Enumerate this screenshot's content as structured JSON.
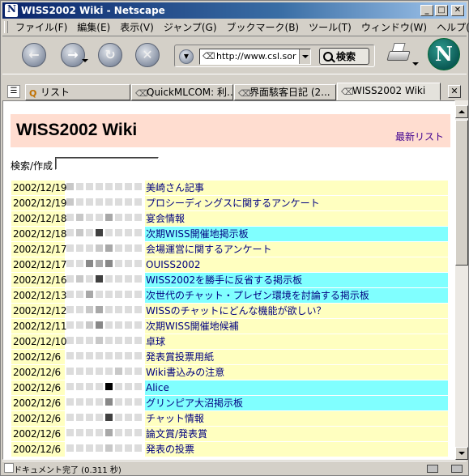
{
  "window": {
    "title": "WISS2002 Wiki - Netscape",
    "controls": {
      "minimize": "_",
      "maximize": "□",
      "close": "✕"
    }
  },
  "menu": [
    "ファイル(F)",
    "編集(E)",
    "表示(V)",
    "ジャンプ(G)",
    "ブックマーク(B)",
    "ツール(T)",
    "ウィンドウ(W)",
    "ヘルプ(H)"
  ],
  "toolbar": {
    "url": "http://www.csl.sor",
    "search_label": "検索",
    "back_glyph": "←",
    "forward_glyph": "→",
    "reload_glyph": "↻",
    "stop_glyph": "✕",
    "logo_letter": "N"
  },
  "tabs": [
    {
      "label": "リスト",
      "icon": "q-icon",
      "active": false
    },
    {
      "label": "QuickMLCOM: 利...",
      "icon": "page-icon",
      "active": false
    },
    {
      "label": "界面駭客日記 (2...",
      "icon": "page-icon",
      "active": false
    },
    {
      "label": "WISS2002 Wiki",
      "icon": "page-icon",
      "active": true
    }
  ],
  "page": {
    "title": "WISS2002 Wiki",
    "recent_link": "最新リスト",
    "search_label": "検索/作成"
  },
  "colors": {
    "header_bg": "#ffddd0",
    "row_bg": "#ffffc0",
    "row_highlight": "#80ffff",
    "link": "#000080"
  },
  "entries": [
    {
      "date": "2002/12/19",
      "title": "美崎さん記事",
      "highlight": false,
      "activity": [
        1,
        0,
        0,
        0,
        0,
        0,
        0,
        0
      ]
    },
    {
      "date": "2002/12/19",
      "title": "プロシーディングスに関するアンケート",
      "highlight": false,
      "activity": [
        1,
        0,
        0,
        0,
        0,
        0,
        0,
        0
      ]
    },
    {
      "date": "2002/12/18",
      "title": "宴会情報",
      "highlight": false,
      "activity": [
        0,
        1,
        0,
        0,
        2,
        0,
        0,
        0
      ]
    },
    {
      "date": "2002/12/18",
      "title": "次期WISS開催地掲示板",
      "highlight": true,
      "activity": [
        0,
        1,
        0,
        4,
        0,
        0,
        0,
        0
      ]
    },
    {
      "date": "2002/12/17",
      "title": "会場運営に関するアンケート",
      "highlight": false,
      "activity": [
        0,
        0,
        0,
        1,
        2,
        0,
        0,
        0
      ]
    },
    {
      "date": "2002/12/17",
      "title": "OUISS2002",
      "highlight": false,
      "activity": [
        0,
        0,
        3,
        2,
        3,
        0,
        0,
        0
      ]
    },
    {
      "date": "2002/12/16",
      "title": "WISS2002を勝手に反省する掲示板",
      "highlight": true,
      "activity": [
        0,
        1,
        0,
        4,
        0,
        0,
        0,
        0
      ]
    },
    {
      "date": "2002/12/13",
      "title": "次世代のチャット・プレゼン環境を討論する掲示板",
      "highlight": true,
      "activity": [
        0,
        0,
        2,
        0,
        0,
        0,
        0,
        0
      ]
    },
    {
      "date": "2002/12/12",
      "title": "WISSのチャットにどんな機能が欲しい？",
      "highlight": false,
      "activity": [
        0,
        0,
        1,
        2,
        0,
        0,
        0,
        0
      ]
    },
    {
      "date": "2002/12/11",
      "title": "次期WISS開催地候補",
      "highlight": false,
      "activity": [
        0,
        0,
        1,
        3,
        0,
        0,
        0,
        0
      ]
    },
    {
      "date": "2002/12/10",
      "title": "卓球",
      "highlight": false,
      "activity": [
        0,
        0,
        0,
        1,
        0,
        0,
        0,
        0
      ]
    },
    {
      "date": "2002/12/6",
      "title": "発表賞投票用紙",
      "highlight": false,
      "activity": [
        0,
        0,
        0,
        0,
        0,
        0,
        0,
        0
      ]
    },
    {
      "date": "2002/12/6",
      "title": "Wiki書込みの注意",
      "highlight": false,
      "activity": [
        0,
        0,
        0,
        0,
        0,
        1,
        0,
        0
      ]
    },
    {
      "date": "2002/12/6",
      "title": "Alice",
      "highlight": true,
      "activity": [
        0,
        0,
        0,
        0,
        5,
        0,
        0,
        0
      ]
    },
    {
      "date": "2002/12/6",
      "title": "グリンピア大沼掲示板",
      "highlight": true,
      "activity": [
        0,
        0,
        0,
        0,
        3,
        0,
        0,
        0
      ]
    },
    {
      "date": "2002/12/6",
      "title": "チャット情報",
      "highlight": false,
      "activity": [
        0,
        0,
        0,
        0,
        4,
        0,
        0,
        0
      ]
    },
    {
      "date": "2002/12/6",
      "title": "論文賞/発表賞",
      "highlight": false,
      "activity": [
        0,
        0,
        0,
        0,
        2,
        0,
        0,
        0
      ]
    },
    {
      "date": "2002/12/6",
      "title": "発表の投票",
      "highlight": false,
      "activity": [
        0,
        0,
        0,
        0,
        1,
        0,
        0,
        0
      ]
    }
  ],
  "status": {
    "text": "ドキュメント完了 (0.311 秒)"
  }
}
